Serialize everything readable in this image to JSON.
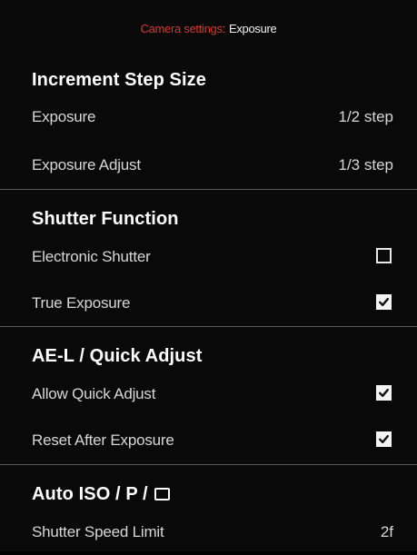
{
  "header": {
    "crumb": "Camera settings:",
    "current": "Exposure"
  },
  "sections": [
    {
      "title": "Increment Step Size",
      "rows": [
        {
          "label": "Exposure",
          "value": "1/2 step"
        },
        {
          "label": "Exposure Adjust",
          "value": "1/3 step"
        }
      ]
    },
    {
      "title": "Shutter Function",
      "rows": [
        {
          "label": "Electronic Shutter",
          "checked": false
        },
        {
          "label": "True Exposure",
          "checked": true
        }
      ]
    },
    {
      "title": "AE-L / Quick Adjust",
      "rows": [
        {
          "label": "Allow Quick Adjust",
          "checked": true
        },
        {
          "label": "Reset After Exposure",
          "checked": true
        }
      ]
    },
    {
      "title": "Auto ISO / P /",
      "title_icon": "square-icon",
      "rows": [
        {
          "label": "Shutter Speed Limit",
          "value": "2f"
        }
      ]
    }
  ],
  "colors": {
    "background": "#090909",
    "accent": "#d9362a",
    "divider": "#5a5a5a"
  }
}
